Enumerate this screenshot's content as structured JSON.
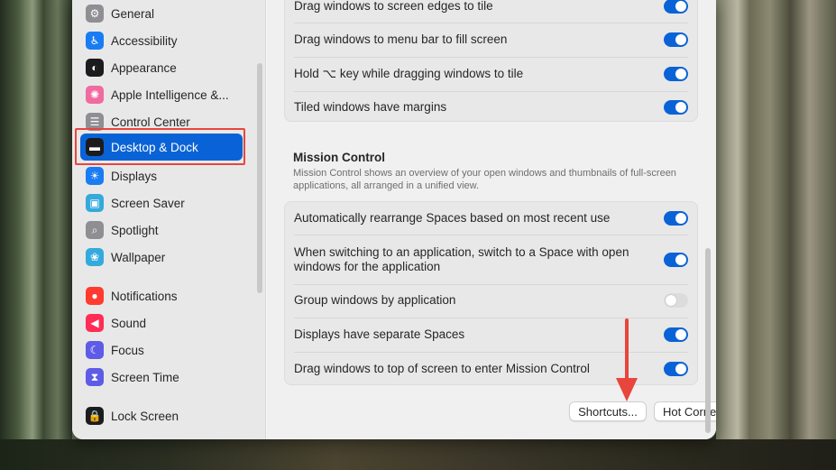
{
  "sidebar": {
    "items": [
      {
        "label": "General",
        "icon": "gear-icon",
        "color": "#8e8e93",
        "glyph": "⚙"
      },
      {
        "label": "Accessibility",
        "icon": "accessibility-icon",
        "color": "#1a7cf2",
        "glyph": "♿"
      },
      {
        "label": "Appearance",
        "icon": "appearance-icon",
        "color": "#1c1c1e",
        "glyph": "◐"
      },
      {
        "label": "Apple Intelligence &...",
        "icon": "apple-intelligence-icon",
        "color": "#f06ba0",
        "glyph": "✺"
      },
      {
        "label": "Control Center",
        "icon": "control-center-icon",
        "color": "#8e8e93",
        "glyph": "☰"
      },
      {
        "label": "Desktop & Dock",
        "icon": "desktop-dock-icon",
        "color": "#1c1c1e",
        "glyph": "▬"
      },
      {
        "label": "Displays",
        "icon": "displays-icon",
        "color": "#1a7cf2",
        "glyph": "☀"
      },
      {
        "label": "Screen Saver",
        "icon": "screen-saver-icon",
        "color": "#34aadc",
        "glyph": "▣"
      },
      {
        "label": "Spotlight",
        "icon": "spotlight-icon",
        "color": "#8e8e93",
        "glyph": "⌕"
      },
      {
        "label": "Wallpaper",
        "icon": "wallpaper-icon",
        "color": "#34aadc",
        "glyph": "❀"
      },
      {
        "label": "Notifications",
        "icon": "notifications-icon",
        "color": "#ff3b30",
        "glyph": "●"
      },
      {
        "label": "Sound",
        "icon": "sound-icon",
        "color": "#ff2d55",
        "glyph": "◀"
      },
      {
        "label": "Focus",
        "icon": "focus-icon",
        "color": "#5e5ce6",
        "glyph": "☾"
      },
      {
        "label": "Screen Time",
        "icon": "screen-time-icon",
        "color": "#5e5ce6",
        "glyph": "⧗"
      },
      {
        "label": "Lock Screen",
        "icon": "lock-icon",
        "color": "#1c1c1e",
        "glyph": "🔒"
      }
    ],
    "selected": "Desktop & Dock"
  },
  "windows_group": {
    "rows": [
      {
        "label": "Drag windows to screen edges to tile",
        "on": true
      },
      {
        "label": "Drag windows to menu bar to fill screen",
        "on": true
      },
      {
        "label": "Hold ⌥ key while dragging windows to tile",
        "on": true
      },
      {
        "label": "Tiled windows have margins",
        "on": true
      }
    ]
  },
  "mission_control": {
    "title": "Mission Control",
    "description": "Mission Control shows an overview of your open windows and thumbnails of full-screen applications, all arranged in a unified view.",
    "rows": [
      {
        "label": "Automatically rearrange Spaces based on most recent use",
        "on": true
      },
      {
        "label": "When switching to an application, switch to a Space with open windows for the application",
        "on": true
      },
      {
        "label": "Group windows by application",
        "on": false
      },
      {
        "label": "Displays have separate Spaces",
        "on": true
      },
      {
        "label": "Drag windows to top of screen to enter Mission Control",
        "on": true
      }
    ]
  },
  "buttons": {
    "shortcuts": "Shortcuts...",
    "hot_corners": "Hot Corners...",
    "help": "?"
  },
  "colors": {
    "accent": "#0a63d6",
    "highlight_box": "#e8453c",
    "arrow": "#e8453c"
  }
}
